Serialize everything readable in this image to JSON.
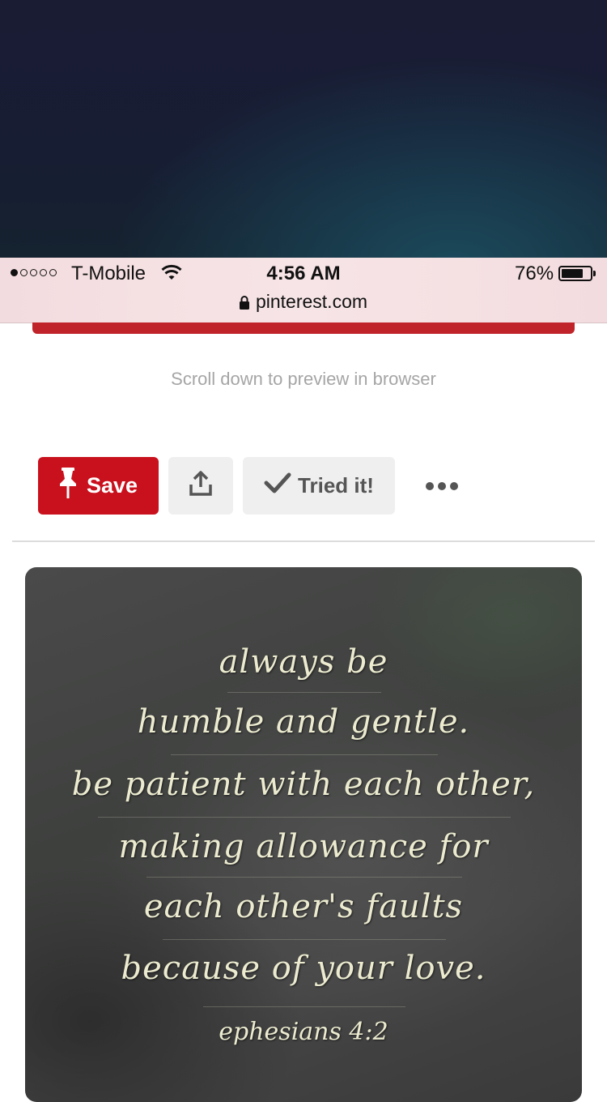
{
  "status_bar": {
    "carrier": "T-Mobile",
    "time": "4:56 AM",
    "battery_percent": "76%",
    "battery_level": 0.76,
    "signal_bars_filled": 1,
    "signal_bars_total": 5
  },
  "browser": {
    "url": "pinterest.com"
  },
  "page": {
    "hint": "Scroll down to preview in browser"
  },
  "actions": {
    "save_label": "Save",
    "tried_label": "Tried it!"
  },
  "pin": {
    "quote_lines": [
      "always be",
      "humble and gentle.",
      "be patient with each other,",
      "making allowance for",
      "each other's faults",
      "because of your love."
    ],
    "citation": "ephesians 4:2"
  },
  "colors": {
    "pinterest_red": "#c8111d",
    "status_bar_tint": "#f3dcdf"
  }
}
